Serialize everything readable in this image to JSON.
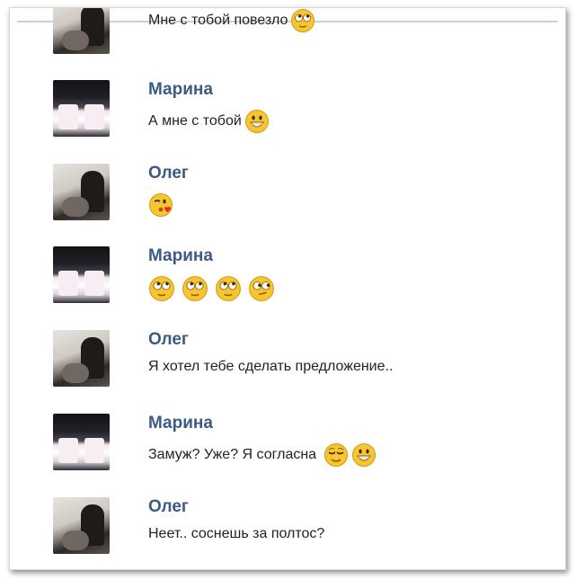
{
  "messages": [
    {
      "author": "",
      "avatar": "oleg",
      "text": "Мне с тобой повезло",
      "smileys": [
        "rolling-eyes"
      ]
    },
    {
      "author": "Марина",
      "avatar": "marina",
      "text": "А мне с тобой",
      "smileys": [
        "grin"
      ]
    },
    {
      "author": "Олег",
      "avatar": "oleg",
      "text": "",
      "smileys": [
        "kiss-wink"
      ]
    },
    {
      "author": "Марина",
      "avatar": "marina",
      "text": "",
      "smileys": [
        "rolling-eyes",
        "rolling-eyes",
        "rolling-eyes",
        "rolling-eyes-side"
      ]
    },
    {
      "author": "Олег",
      "avatar": "oleg",
      "text": "Я хотел тебе сделать предложение..",
      "smileys": []
    },
    {
      "author": "Марина",
      "avatar": "marina",
      "text": "Замуж? Уже? Я согласна",
      "smileys": [
        "relieved",
        "grin"
      ]
    },
    {
      "author": "Олег",
      "avatar": "oleg",
      "text": "Неет.. соснешь за полтос?",
      "smileys": []
    }
  ],
  "colors": {
    "author_name": "#3b5b85",
    "message_text": "#222222",
    "smiley_face": "#f7c62f"
  }
}
